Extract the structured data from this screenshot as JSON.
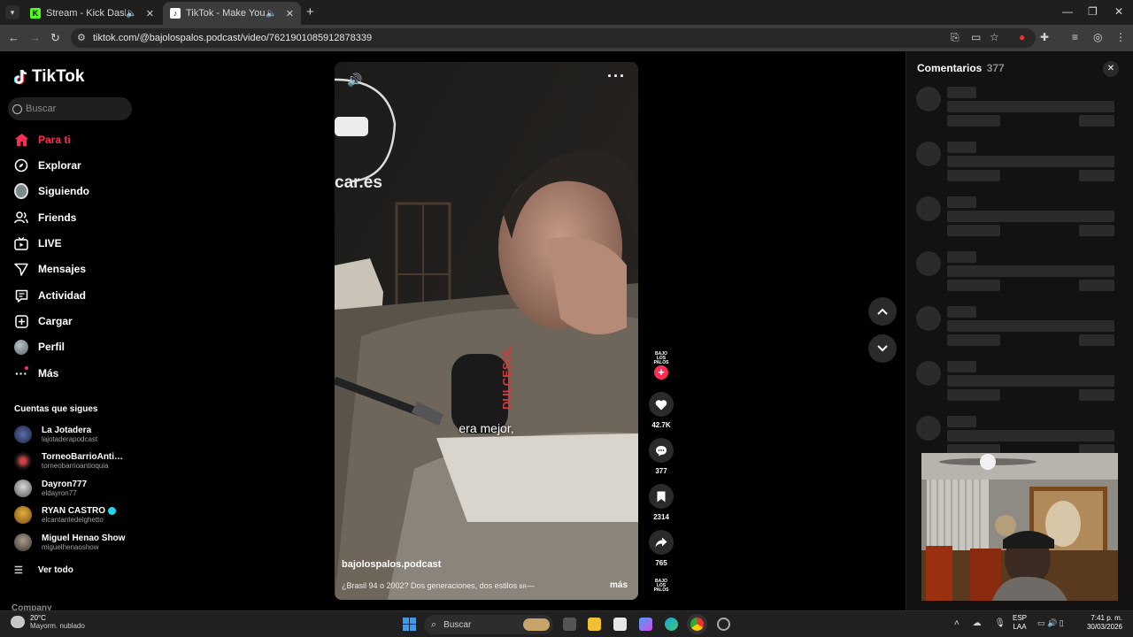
{
  "browser": {
    "tabs": [
      {
        "title": "Stream - Kick Dashboard",
        "favicon": "kick-icon",
        "color": "#53fc18"
      },
      {
        "title": "TikTok - Make Your Day",
        "favicon": "tiktok-icon",
        "color": "#ffffff"
      }
    ],
    "url": "tiktok.com/@bajolospalos.podcast/video/7621901085912878339"
  },
  "sidebar": {
    "logo": "TikTok",
    "search_placeholder": "Buscar",
    "nav": [
      {
        "label": "Para ti",
        "icon": "home-icon",
        "active": true
      },
      {
        "label": "Explorar",
        "icon": "compass-icon"
      },
      {
        "label": "Siguiendo",
        "icon": "following-avatar-icon"
      },
      {
        "label": "Friends",
        "icon": "friends-icon"
      },
      {
        "label": "LIVE",
        "icon": "live-icon"
      },
      {
        "label": "Mensajes",
        "icon": "messages-icon"
      },
      {
        "label": "Actividad",
        "icon": "activity-icon"
      },
      {
        "label": "Cargar",
        "icon": "upload-icon"
      },
      {
        "label": "Perfil",
        "icon": "profile-avatar-icon"
      },
      {
        "label": "Más",
        "icon": "more-dots-icon"
      }
    ],
    "following_title": "Cuentas que sigues",
    "following": [
      {
        "name": "La Jotadera",
        "handle": "lajotaderapodcast",
        "verified": false
      },
      {
        "name": "TorneoBarrioAntioq...",
        "handle": "torneobarrioantioquia",
        "verified": false
      },
      {
        "name": "Dayron777",
        "handle": "eldayron77",
        "verified": false
      },
      {
        "name": "RYAN CASTRO",
        "handle": "elcantantedelghetto",
        "verified": true
      },
      {
        "name": "Miguel Henao Show",
        "handle": "miguelhenaoshow",
        "verified": false
      }
    ],
    "see_all": "Ver todo",
    "company": "Company"
  },
  "video": {
    "subtitle": "era mejor,",
    "username": "bajolospalos.podcast",
    "description": "¿Brasil 94 o 2002? Dos generaciones, dos estilos",
    "desc_suffix": "BR",
    "more": "más",
    "creator_badge": "BAJO LOS PALOS",
    "likes": "42.7K",
    "comments": "377",
    "saves": "2314",
    "shares": "765"
  },
  "comments_panel": {
    "title": "Comentarios",
    "count": "377"
  },
  "taskbar": {
    "temperature": "20°C",
    "weather": "Mayorm. nublado",
    "search": "Buscar",
    "lang1": "ESP",
    "lang2": "LAA",
    "time": "7:41 p. m.",
    "date": "30/03/2026"
  }
}
